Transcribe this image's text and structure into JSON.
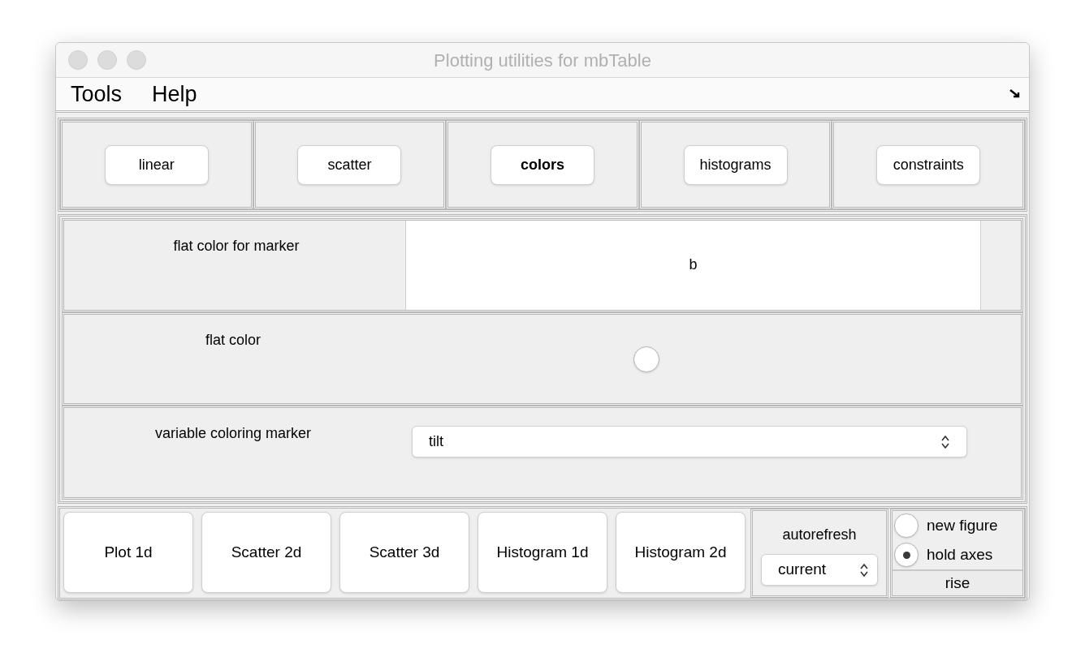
{
  "window": {
    "title": "Plotting utilities for mbTable"
  },
  "menu": [
    "Tools",
    "Help"
  ],
  "tabs": [
    {
      "label": "linear",
      "selected": false
    },
    {
      "label": "scatter",
      "selected": false
    },
    {
      "label": "colors",
      "selected": true
    },
    {
      "label": "histograms",
      "selected": false
    },
    {
      "label": "constraints",
      "selected": false
    }
  ],
  "rows": [
    {
      "kind": "text",
      "label": "flat color for marker",
      "value": "b"
    },
    {
      "kind": "radio",
      "label": "flat color",
      "checked": false
    },
    {
      "kind": "select",
      "label": "variable coloring marker",
      "value": "tilt"
    }
  ],
  "plot_buttons": [
    "Plot 1d",
    "Scatter 2d",
    "Scatter 3d",
    "Histogram 1d",
    "Histogram 2d"
  ],
  "autorefresh": {
    "label": "autorefresh",
    "value": "current"
  },
  "mode_options": [
    {
      "label": "new figure",
      "selected": false
    },
    {
      "label": "hold axes",
      "selected": true
    }
  ],
  "rise_button": "rise"
}
